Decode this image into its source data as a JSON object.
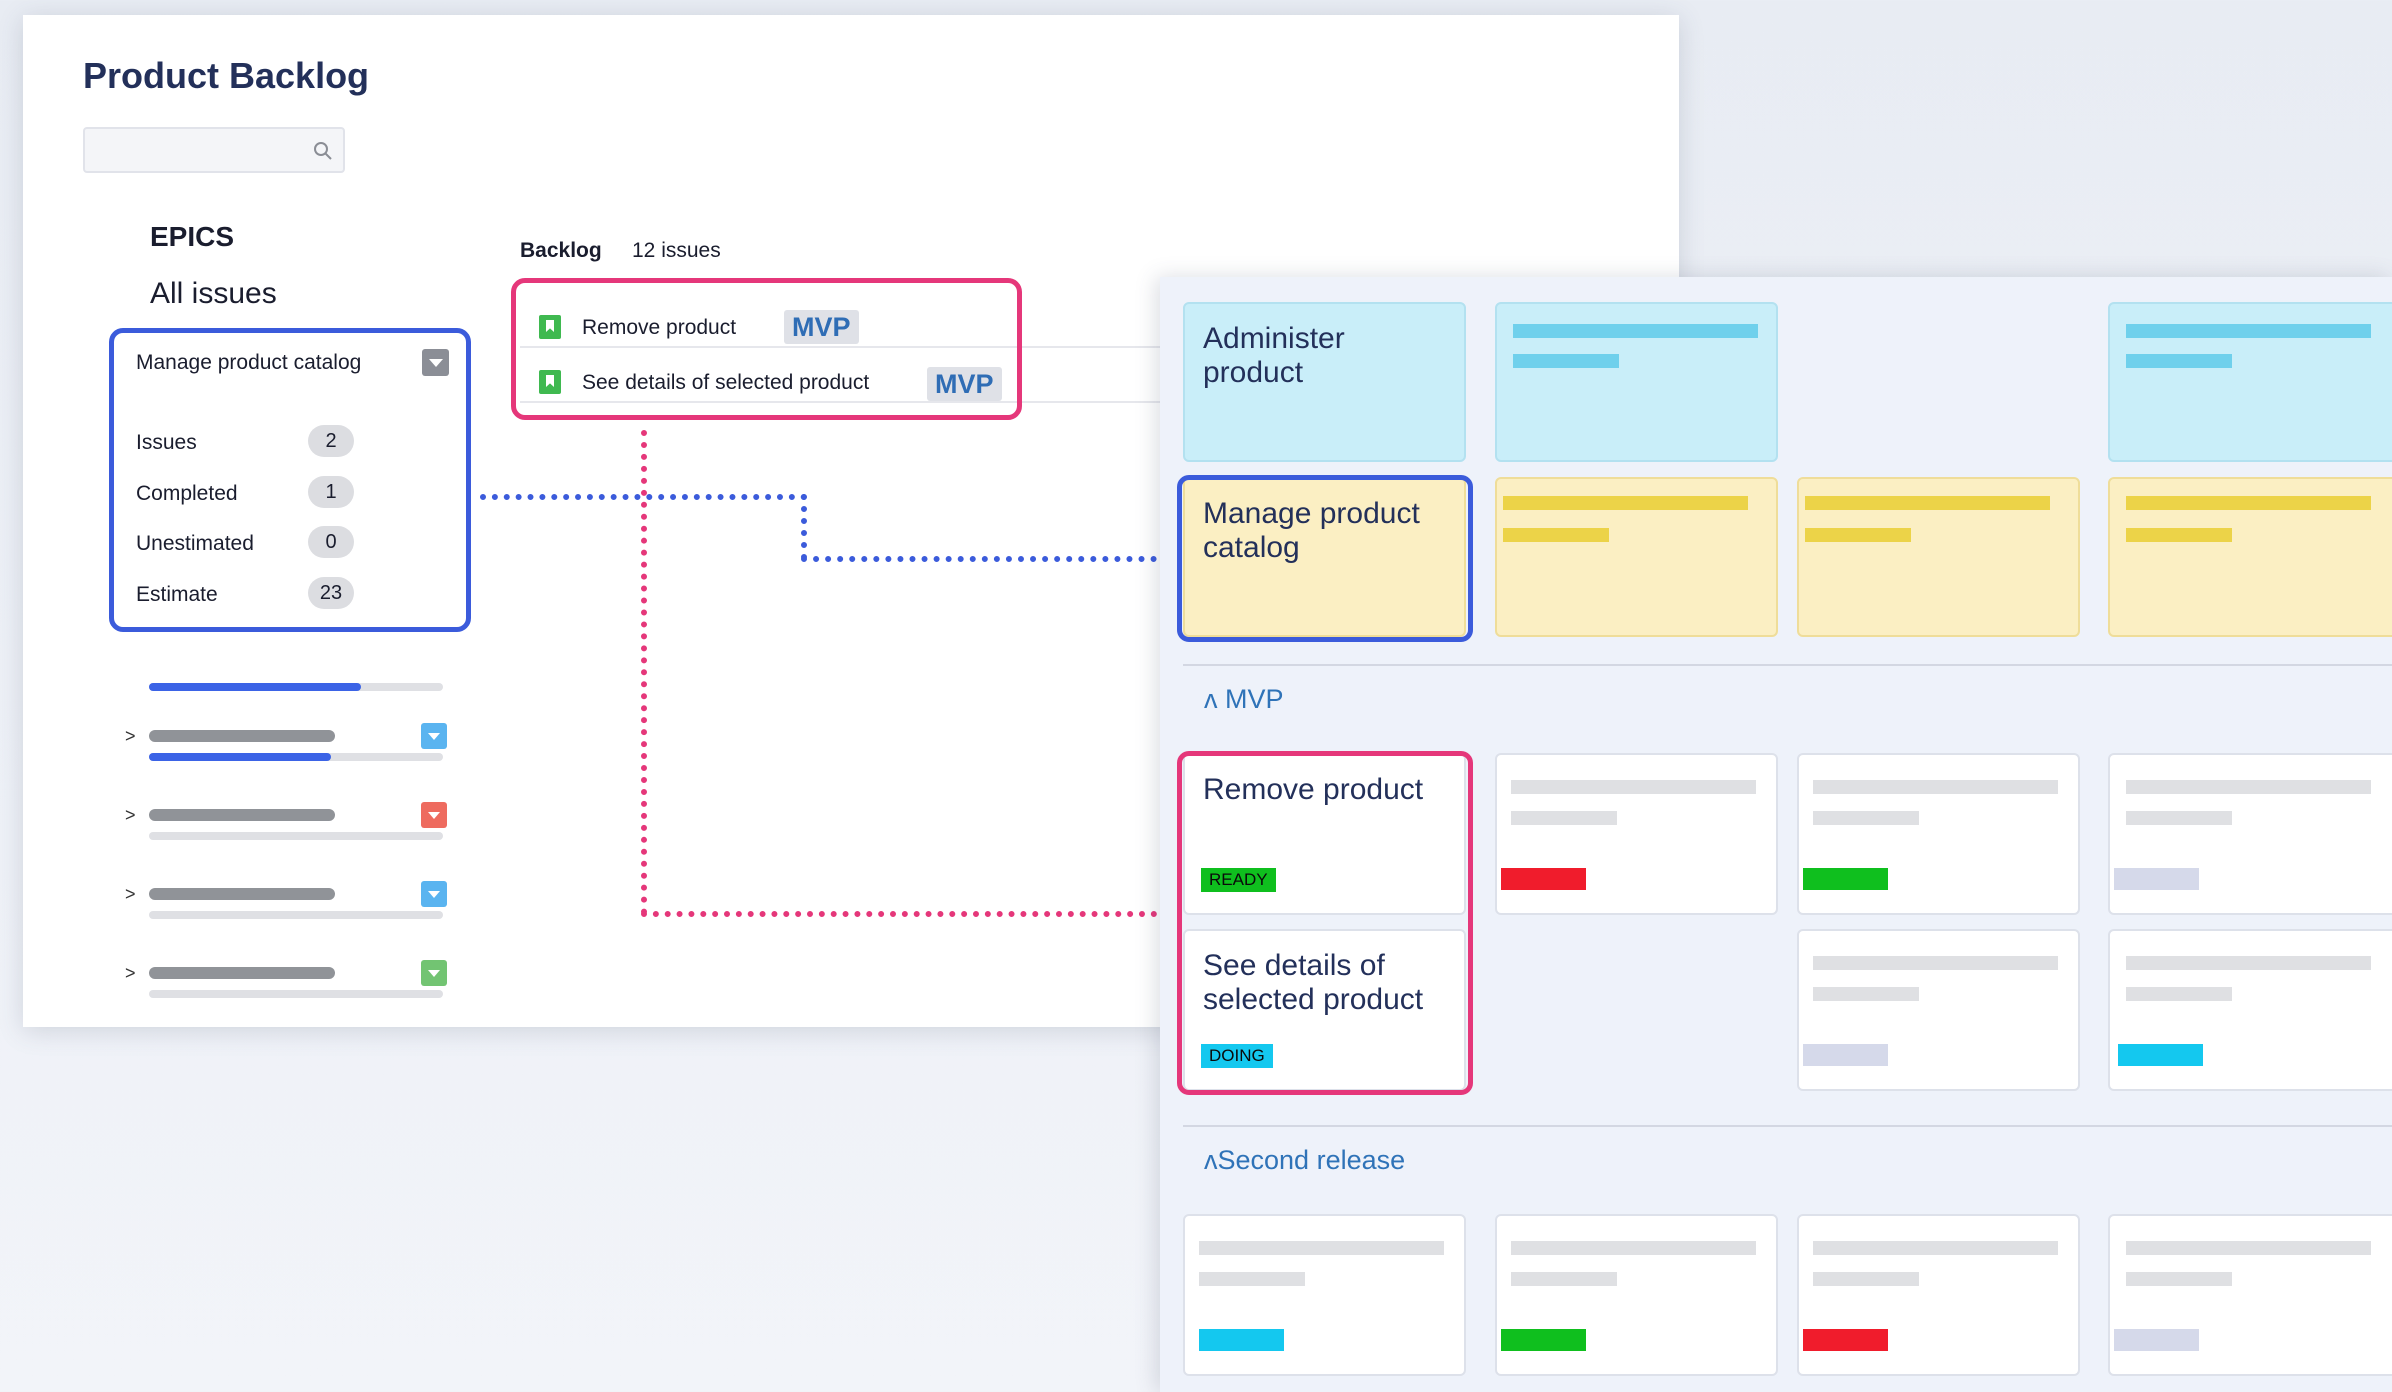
{
  "backlog": {
    "title": "Product Backlog",
    "search": {
      "placeholder": ""
    },
    "epics_heading": "EPICS",
    "all_issues": "All issues",
    "epic": {
      "name": "Manage product catalog",
      "stats": [
        {
          "label": "Issues",
          "value": "2"
        },
        {
          "label": "Completed",
          "value": "1"
        },
        {
          "label": "Unestimated",
          "value": "0"
        },
        {
          "label": "Estimate",
          "value": "23"
        }
      ],
      "progress": 0.72
    },
    "collapsed_epics": [
      {
        "chevron": ">",
        "color": "#5ab4f0",
        "progress": 0.62
      },
      {
        "chevron": ">",
        "color": "#ee6b5f",
        "progress": 0
      },
      {
        "chevron": ">",
        "color": "#5ab4f0",
        "progress": 0
      },
      {
        "chevron": ">",
        "color": "#72c472",
        "progress": 0
      }
    ],
    "list_label": "Backlog",
    "issue_count": "12 issues",
    "issues": [
      {
        "summary": "Remove product",
        "tag": "MVP"
      },
      {
        "summary": "See details of selected product",
        "tag": "MVP"
      }
    ]
  },
  "story_map": {
    "activities": [
      {
        "title": "Administer product"
      }
    ],
    "epics": [
      {
        "title": "Manage product catalog"
      }
    ],
    "releases": [
      {
        "label": "ʌ MVP"
      },
      {
        "label": "ʌSecond release"
      }
    ],
    "stories": [
      {
        "title": "Remove product",
        "status": "READY",
        "status_color": "#0fbf1e"
      },
      {
        "title": "See details of selected product",
        "status": "DOING",
        "status_color": "#14c8ef"
      }
    ],
    "colors": {
      "red": "#f01c2c",
      "green": "#0fbf1e",
      "cyan": "#14c8ef",
      "lavender": "#d5d9ea",
      "blue_highlight": "#3b5bdb",
      "pink_highlight": "#e5377a"
    }
  }
}
